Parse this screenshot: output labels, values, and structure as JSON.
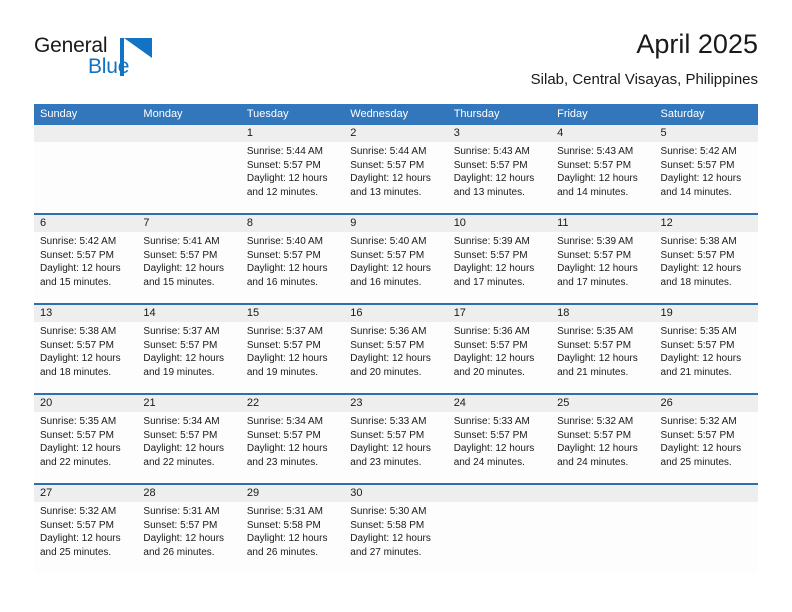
{
  "logo": {
    "word_top": "General",
    "word_bottom": "Blue",
    "accent_color": "#1273c4"
  },
  "header": {
    "title": "April 2025",
    "subtitle": "Silab, Central Visayas, Philippines"
  },
  "theme": {
    "header_blue": "#3276bc",
    "row_divider_blue": "#2f6fb0",
    "daynum_band": "#eeeeee"
  },
  "calendar": {
    "weekdays": [
      "Sunday",
      "Monday",
      "Tuesday",
      "Wednesday",
      "Thursday",
      "Friday",
      "Saturday"
    ],
    "weeks": [
      [
        {
          "day": "",
          "lines": []
        },
        {
          "day": "",
          "lines": []
        },
        {
          "day": "1",
          "lines": [
            "Sunrise: 5:44 AM",
            "Sunset: 5:57 PM",
            "Daylight: 12 hours",
            "and 12 minutes."
          ]
        },
        {
          "day": "2",
          "lines": [
            "Sunrise: 5:44 AM",
            "Sunset: 5:57 PM",
            "Daylight: 12 hours",
            "and 13 minutes."
          ]
        },
        {
          "day": "3",
          "lines": [
            "Sunrise: 5:43 AM",
            "Sunset: 5:57 PM",
            "Daylight: 12 hours",
            "and 13 minutes."
          ]
        },
        {
          "day": "4",
          "lines": [
            "Sunrise: 5:43 AM",
            "Sunset: 5:57 PM",
            "Daylight: 12 hours",
            "and 14 minutes."
          ]
        },
        {
          "day": "5",
          "lines": [
            "Sunrise: 5:42 AM",
            "Sunset: 5:57 PM",
            "Daylight: 12 hours",
            "and 14 minutes."
          ]
        }
      ],
      [
        {
          "day": "6",
          "lines": [
            "Sunrise: 5:42 AM",
            "Sunset: 5:57 PM",
            "Daylight: 12 hours",
            "and 15 minutes."
          ]
        },
        {
          "day": "7",
          "lines": [
            "Sunrise: 5:41 AM",
            "Sunset: 5:57 PM",
            "Daylight: 12 hours",
            "and 15 minutes."
          ]
        },
        {
          "day": "8",
          "lines": [
            "Sunrise: 5:40 AM",
            "Sunset: 5:57 PM",
            "Daylight: 12 hours",
            "and 16 minutes."
          ]
        },
        {
          "day": "9",
          "lines": [
            "Sunrise: 5:40 AM",
            "Sunset: 5:57 PM",
            "Daylight: 12 hours",
            "and 16 minutes."
          ]
        },
        {
          "day": "10",
          "lines": [
            "Sunrise: 5:39 AM",
            "Sunset: 5:57 PM",
            "Daylight: 12 hours",
            "and 17 minutes."
          ]
        },
        {
          "day": "11",
          "lines": [
            "Sunrise: 5:39 AM",
            "Sunset: 5:57 PM",
            "Daylight: 12 hours",
            "and 17 minutes."
          ]
        },
        {
          "day": "12",
          "lines": [
            "Sunrise: 5:38 AM",
            "Sunset: 5:57 PM",
            "Daylight: 12 hours",
            "and 18 minutes."
          ]
        }
      ],
      [
        {
          "day": "13",
          "lines": [
            "Sunrise: 5:38 AM",
            "Sunset: 5:57 PM",
            "Daylight: 12 hours",
            "and 18 minutes."
          ]
        },
        {
          "day": "14",
          "lines": [
            "Sunrise: 5:37 AM",
            "Sunset: 5:57 PM",
            "Daylight: 12 hours",
            "and 19 minutes."
          ]
        },
        {
          "day": "15",
          "lines": [
            "Sunrise: 5:37 AM",
            "Sunset: 5:57 PM",
            "Daylight: 12 hours",
            "and 19 minutes."
          ]
        },
        {
          "day": "16",
          "lines": [
            "Sunrise: 5:36 AM",
            "Sunset: 5:57 PM",
            "Daylight: 12 hours",
            "and 20 minutes."
          ]
        },
        {
          "day": "17",
          "lines": [
            "Sunrise: 5:36 AM",
            "Sunset: 5:57 PM",
            "Daylight: 12 hours",
            "and 20 minutes."
          ]
        },
        {
          "day": "18",
          "lines": [
            "Sunrise: 5:35 AM",
            "Sunset: 5:57 PM",
            "Daylight: 12 hours",
            "and 21 minutes."
          ]
        },
        {
          "day": "19",
          "lines": [
            "Sunrise: 5:35 AM",
            "Sunset: 5:57 PM",
            "Daylight: 12 hours",
            "and 21 minutes."
          ]
        }
      ],
      [
        {
          "day": "20",
          "lines": [
            "Sunrise: 5:35 AM",
            "Sunset: 5:57 PM",
            "Daylight: 12 hours",
            "and 22 minutes."
          ]
        },
        {
          "day": "21",
          "lines": [
            "Sunrise: 5:34 AM",
            "Sunset: 5:57 PM",
            "Daylight: 12 hours",
            "and 22 minutes."
          ]
        },
        {
          "day": "22",
          "lines": [
            "Sunrise: 5:34 AM",
            "Sunset: 5:57 PM",
            "Daylight: 12 hours",
            "and 23 minutes."
          ]
        },
        {
          "day": "23",
          "lines": [
            "Sunrise: 5:33 AM",
            "Sunset: 5:57 PM",
            "Daylight: 12 hours",
            "and 23 minutes."
          ]
        },
        {
          "day": "24",
          "lines": [
            "Sunrise: 5:33 AM",
            "Sunset: 5:57 PM",
            "Daylight: 12 hours",
            "and 24 minutes."
          ]
        },
        {
          "day": "25",
          "lines": [
            "Sunrise: 5:32 AM",
            "Sunset: 5:57 PM",
            "Daylight: 12 hours",
            "and 24 minutes."
          ]
        },
        {
          "day": "26",
          "lines": [
            "Sunrise: 5:32 AM",
            "Sunset: 5:57 PM",
            "Daylight: 12 hours",
            "and 25 minutes."
          ]
        }
      ],
      [
        {
          "day": "27",
          "lines": [
            "Sunrise: 5:32 AM",
            "Sunset: 5:57 PM",
            "Daylight: 12 hours",
            "and 25 minutes."
          ]
        },
        {
          "day": "28",
          "lines": [
            "Sunrise: 5:31 AM",
            "Sunset: 5:57 PM",
            "Daylight: 12 hours",
            "and 26 minutes."
          ]
        },
        {
          "day": "29",
          "lines": [
            "Sunrise: 5:31 AM",
            "Sunset: 5:58 PM",
            "Daylight: 12 hours",
            "and 26 minutes."
          ]
        },
        {
          "day": "30",
          "lines": [
            "Sunrise: 5:30 AM",
            "Sunset: 5:58 PM",
            "Daylight: 12 hours",
            "and 27 minutes."
          ]
        },
        {
          "day": "",
          "lines": []
        },
        {
          "day": "",
          "lines": []
        },
        {
          "day": "",
          "lines": []
        }
      ]
    ]
  }
}
